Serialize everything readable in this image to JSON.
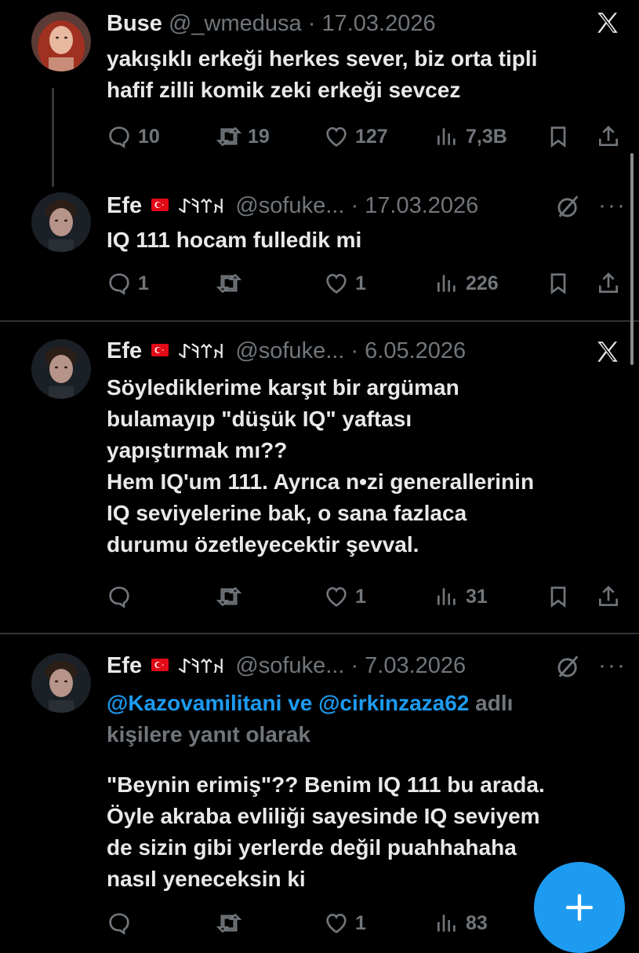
{
  "tweets": [
    {
      "name": "Buse",
      "handle": "@_wmedusa",
      "separator": "·",
      "date": "17.03.2026",
      "text_lines": [
        "yakışıklı erkeği herkes sever, biz orta tipli",
        "hafif zilli komik zeki erkeği sevcez"
      ],
      "stats": {
        "replies": "10",
        "retweets": "19",
        "likes": "127",
        "views": "7,3B"
      },
      "top_icon": "x-logo-icon"
    },
    {
      "name": "Efe",
      "runes": "𐰴𐰼𐰚𐰀",
      "handle": "@sofuke...",
      "separator": "·",
      "date": "17.03.2026",
      "text_lines": [
        "IQ 111 hocam fulledik mi"
      ],
      "stats": {
        "replies": "1",
        "retweets": "",
        "likes": "1",
        "views": "226"
      },
      "top_icon": "grok-icon"
    },
    {
      "name": "Efe",
      "runes": "𐰴𐰼𐰚𐰀",
      "handle": "@sofuke...",
      "separator": "·",
      "date": "6.05.2026",
      "text_lines": [
        "Söylediklerime karşıt bir argüman",
        "bulamayıp \"düşük IQ\" yaftası",
        "yapıştırmak mı??",
        "Hem IQ'um 111. Ayrıca n•zi generallerinin",
        "IQ seviyelerine bak, o sana fazlaca",
        "durumu özetleyecektir şevval."
      ],
      "stats": {
        "replies": "",
        "retweets": "",
        "likes": "1",
        "views": "31"
      },
      "top_icon": "x-logo-icon"
    },
    {
      "name": "Efe",
      "runes": "𐰴𐰼𐰚𐰀",
      "handle": "@sofuke...",
      "separator": "·",
      "date": "7.03.2026",
      "reply_to": {
        "mention1": "@Kazovamilitani",
        "joiner": "ve",
        "mention2": "@cirkinzaza62",
        "suffix": "adlı",
        "line2": "kişilere yanıt olarak"
      },
      "text_lines": [
        "\"Beynin erimiş\"?? Benim IQ 111 bu arada.",
        "Öyle akraba evliliği sayesinde IQ seviyem",
        "de sizin gibi yerlerde değil puahhahaha",
        "nasıl yeneceksin ki"
      ],
      "stats": {
        "replies": "",
        "retweets": "",
        "likes": "1",
        "views": "83"
      },
      "top_icon": "grok-icon"
    }
  ],
  "colors": {
    "background": "#000000",
    "text": "#e7e9ea",
    "muted": "#71767b",
    "accent": "#1d9bf0",
    "divider": "#2f3336"
  },
  "fab": {
    "icon": "plus-icon"
  }
}
